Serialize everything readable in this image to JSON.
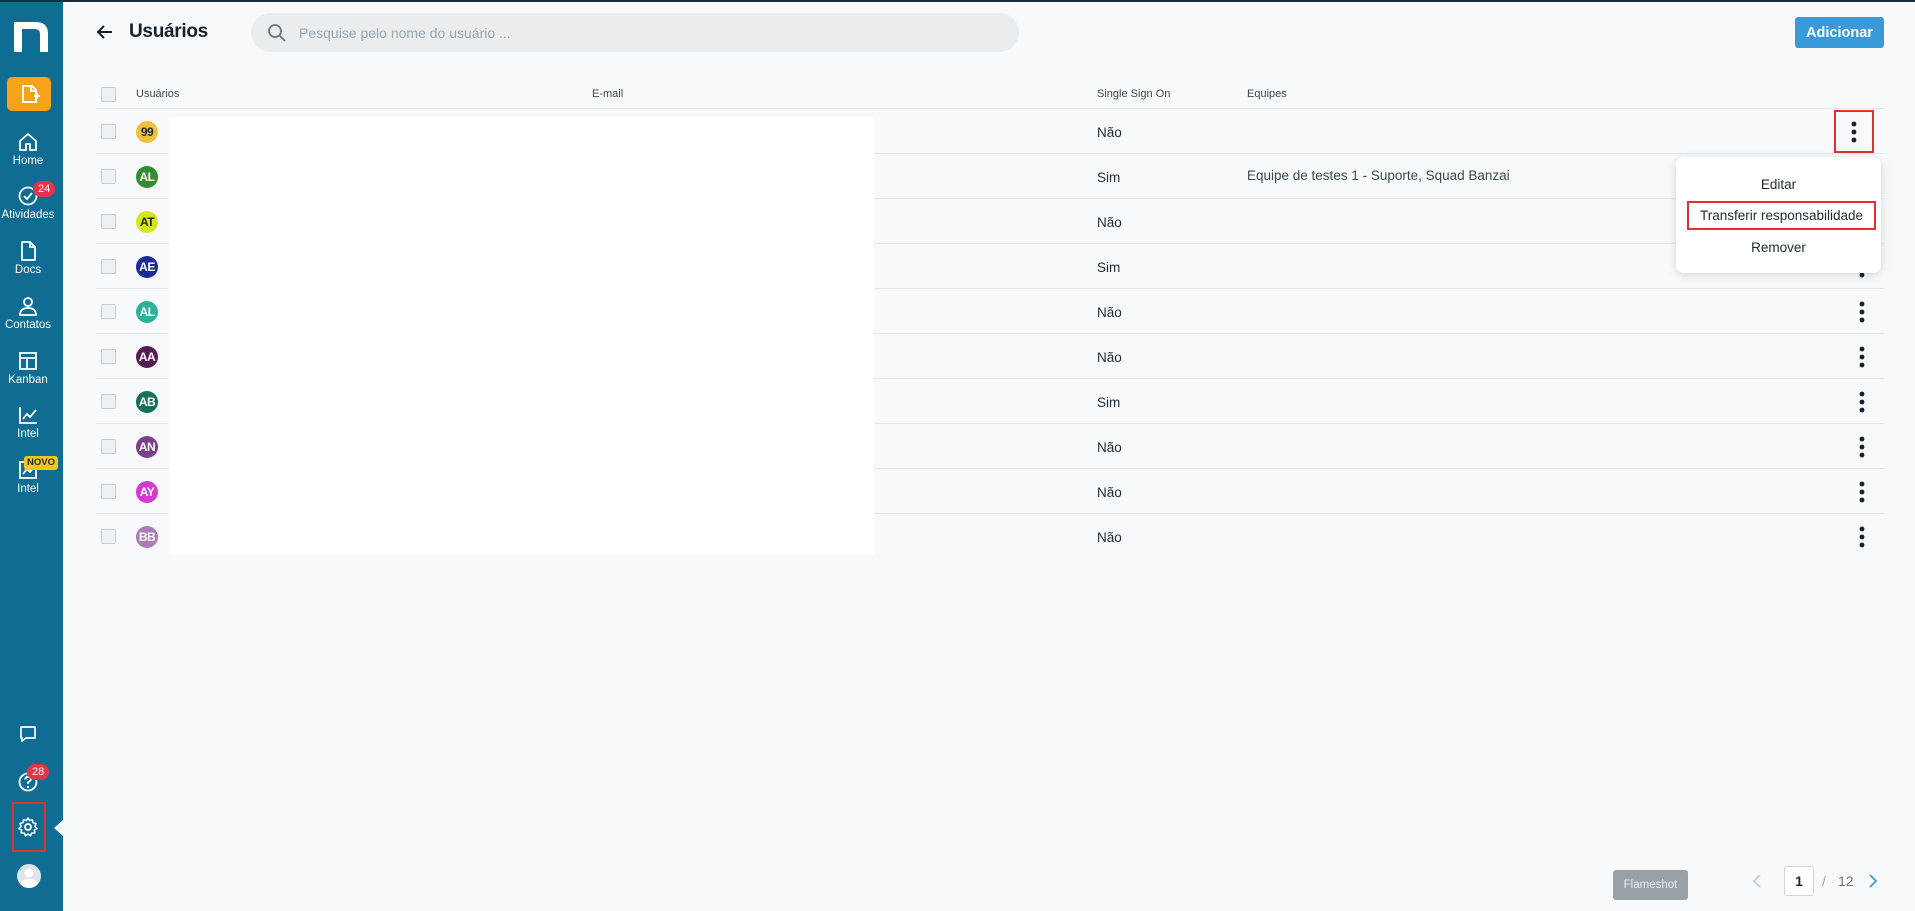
{
  "header": {
    "title": "Usuários",
    "search_placeholder": "Pesquise pelo nome do usuário ...",
    "add_label": "Adicionar"
  },
  "sidebar": {
    "items": [
      {
        "label": "Home",
        "icon": "home-icon"
      },
      {
        "label": "Atividades",
        "icon": "check-circle-icon",
        "badge": "24"
      },
      {
        "label": "Docs",
        "icon": "document-icon"
      },
      {
        "label": "Contatos",
        "icon": "person-icon"
      },
      {
        "label": "Kanban",
        "icon": "kanban-icon"
      },
      {
        "label": "Intel",
        "icon": "line-chart-icon"
      },
      {
        "label": "Intel",
        "icon": "chart-frame-icon",
        "badge": "NOVO"
      }
    ],
    "help_badge": "28"
  },
  "table": {
    "columns": [
      "Usuários",
      "E-mail",
      "Single Sign On",
      "Equipes"
    ],
    "rows": [
      {
        "initials": "99",
        "color": "#f0c13a",
        "text_color": "#1e2a33",
        "sso": "Não",
        "teams": ""
      },
      {
        "initials": "AL",
        "color": "#2f8f2f",
        "text_color": "#ffffff",
        "sso": "Sim",
        "teams": "Equipe de testes 1 - Suporte, Squad Banzai"
      },
      {
        "initials": "AT",
        "color": "#d7e61c",
        "text_color": "#1e2a33",
        "sso": "Não",
        "teams": ""
      },
      {
        "initials": "AE",
        "color": "#1d2a99",
        "text_color": "#ffffff",
        "sso": "Sim",
        "teams": ""
      },
      {
        "initials": "AL",
        "color": "#2bb39a",
        "text_color": "#ffffff",
        "sso": "Não",
        "teams": ""
      },
      {
        "initials": "AA",
        "color": "#5a1a55",
        "text_color": "#ffffff",
        "sso": "Não",
        "teams": ""
      },
      {
        "initials": "AB",
        "color": "#17705a",
        "text_color": "#ffffff",
        "sso": "Sim",
        "teams": ""
      },
      {
        "initials": "AN",
        "color": "#7b3f8c",
        "text_color": "#ffffff",
        "sso": "Não",
        "teams": ""
      },
      {
        "initials": "AY",
        "color": "#d33bd0",
        "text_color": "#ffffff",
        "sso": "Não",
        "teams": ""
      },
      {
        "initials": "BB",
        "color": "#b07ab8",
        "text_color": "#ffffff",
        "sso": "Não",
        "teams": ""
      }
    ]
  },
  "menu": {
    "items": [
      "Editar",
      "Transferir responsabilidade",
      "Remover"
    ]
  },
  "footer": {
    "flameshot": "Flameshot",
    "page_current": "1",
    "page_sep": "/",
    "page_total": "12"
  },
  "colors": {
    "sidebar": "#0f6d94",
    "accent": "#3a9ad9",
    "new_doc": "#f7a21b",
    "badge": "#e8324a",
    "highlight": "#e03131"
  }
}
